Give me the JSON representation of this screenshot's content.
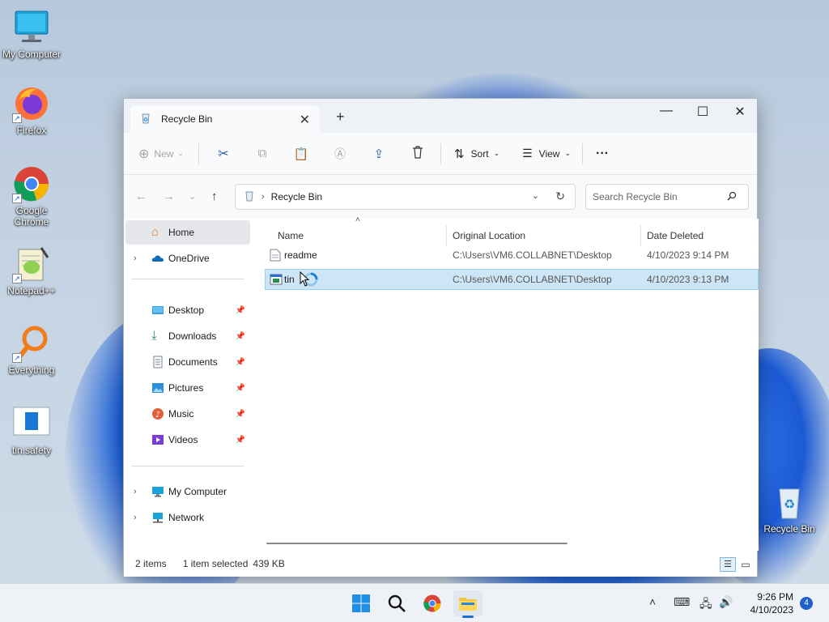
{
  "desktop": {
    "icons": [
      {
        "label": "My Computer"
      },
      {
        "label": "Firefox"
      },
      {
        "label": "Google Chrome"
      },
      {
        "label": "Notepad++"
      },
      {
        "label": "Everything"
      },
      {
        "label": "tin.safety"
      },
      {
        "label": "Recycle Bin"
      }
    ]
  },
  "window": {
    "tab_title": "Recycle Bin",
    "toolbar": {
      "new_label": "New",
      "sort_label": "Sort",
      "view_label": "View",
      "more_label": "···"
    },
    "address": {
      "path": "Recycle Bin",
      "search_placeholder": "Search Recycle Bin"
    },
    "sidebar": {
      "items": [
        {
          "label": "Home"
        },
        {
          "label": "OneDrive"
        },
        {
          "label": "Desktop"
        },
        {
          "label": "Downloads"
        },
        {
          "label": "Documents"
        },
        {
          "label": "Pictures"
        },
        {
          "label": "Music"
        },
        {
          "label": "Videos"
        },
        {
          "label": "My Computer"
        },
        {
          "label": "Network"
        }
      ]
    },
    "columns": {
      "name": "Name",
      "original_location": "Original Location",
      "date_deleted": "Date Deleted"
    },
    "rows": [
      {
        "name": "readme",
        "location": "C:\\Users\\VM6.COLLABNET\\Desktop",
        "date": "4/10/2023 9:14 PM",
        "selected": false
      },
      {
        "name": "tin",
        "location": "C:\\Users\\VM6.COLLABNET\\Desktop",
        "date": "4/10/2023 9:13 PM",
        "selected": true
      }
    ],
    "status": {
      "count": "2 items",
      "selection": "1 item selected",
      "size": "439 KB"
    }
  },
  "taskbar": {
    "time": "9:26 PM",
    "date": "4/10/2023",
    "notifications": "4"
  },
  "colors": {
    "accent": "#0067c0",
    "selection": "#cde6f7"
  }
}
